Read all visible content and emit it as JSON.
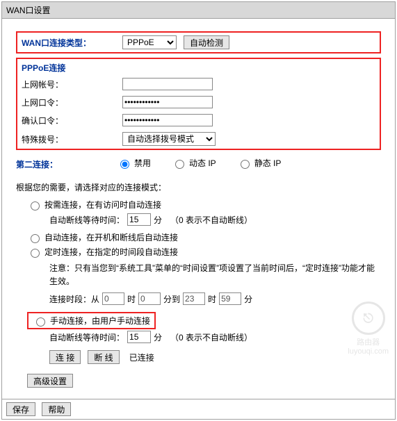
{
  "window": {
    "title": "WAN口设置"
  },
  "wan_type": {
    "label": "WAN口连接类型：",
    "selected": "PPPoE",
    "detect_btn": "自动检测"
  },
  "pppoe": {
    "header": "PPPoE连接",
    "account_label": "上网帐号：",
    "account_value": "",
    "password_label": "上网口令：",
    "password_value": "••••••••••••",
    "confirm_label": "确认口令：",
    "confirm_value": "••••••••••••",
    "special_dial_label": "特殊拨号：",
    "special_dial_selected": "自动选择拨号模式"
  },
  "second_conn": {
    "label": "第二连接：",
    "opt_disable": "禁用",
    "opt_dynamic": "动态 IP",
    "opt_static": "静态 IP"
  },
  "mode_hint": "根据您的需要，请选择对应的连接模式：",
  "modes": {
    "on_demand": "按需连接，在有访问时自动连接",
    "on_demand_wait_label": "自动断线等待时间：",
    "on_demand_wait_value": "15",
    "wait_unit": "分",
    "wait_note": "（0 表示不自动断线）",
    "auto": "自动连接，在开机和断线后自动连接",
    "scheduled": "定时连接，在指定的时间段自动连接",
    "scheduled_note": "注意：只有当您到“系统工具”菜单的“时间设置”项设置了当前时间后，“定时连接”功能才能生效。",
    "time_label_prefix": "连接时段：从",
    "time_h1": "0",
    "time_m1": "0",
    "time_label_to": "分到",
    "time_h2": "23",
    "time_m2": "59",
    "hour_unit": "时",
    "min_unit": "分",
    "manual": "手动连接，由用户手动连接",
    "manual_wait_label": "自动断线等待时间：",
    "manual_wait_value": "15"
  },
  "conn_buttons": {
    "connect": "连 接",
    "disconnect": "断 线",
    "status": "已连接"
  },
  "advanced_btn": "高级设置",
  "footer": {
    "save": "保存",
    "help": "帮助"
  },
  "watermark": {
    "label": "路由器",
    "url": "luyouqi.com",
    "icon": "⎋"
  },
  "chart_data": null
}
